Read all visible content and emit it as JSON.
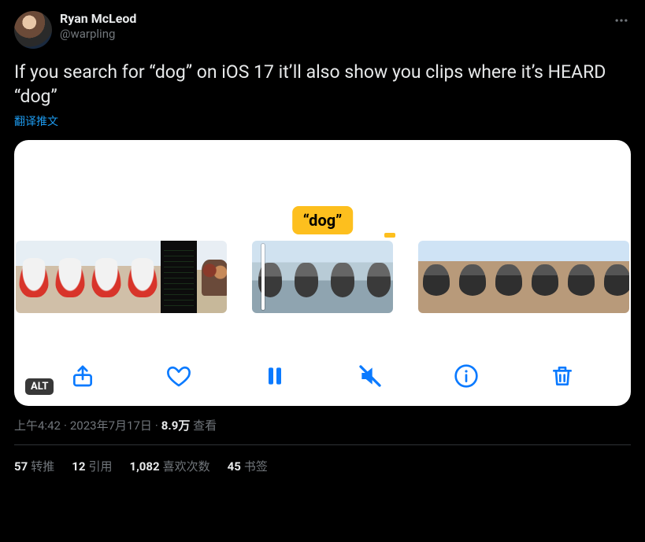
{
  "author": {
    "display_name": "Ryan McLeod",
    "handle": "@warpling"
  },
  "body": "If you search for “dog” on iOS 17 it’ll also show you clips where it’s HEARD “dog”",
  "translate_label": "翻译推文",
  "media": {
    "search_tag": "“dog”",
    "alt_badge": "ALT",
    "toolbar_icons": {
      "share": "share-icon",
      "like": "heart-icon",
      "pause": "pause-icon",
      "mute": "speaker-muted-icon",
      "info": "info-icon",
      "delete": "trash-icon"
    }
  },
  "meta": {
    "time": "上午4:42",
    "date": "2023年7月17日",
    "views_count": "8.9万",
    "views_label": "查看"
  },
  "stats": {
    "retweets": {
      "count": "57",
      "label": "转推"
    },
    "quotes": {
      "count": "12",
      "label": "引用"
    },
    "likes": {
      "count": "1,082",
      "label": "喜欢次数"
    },
    "bookmarks": {
      "count": "45",
      "label": "书签"
    }
  }
}
